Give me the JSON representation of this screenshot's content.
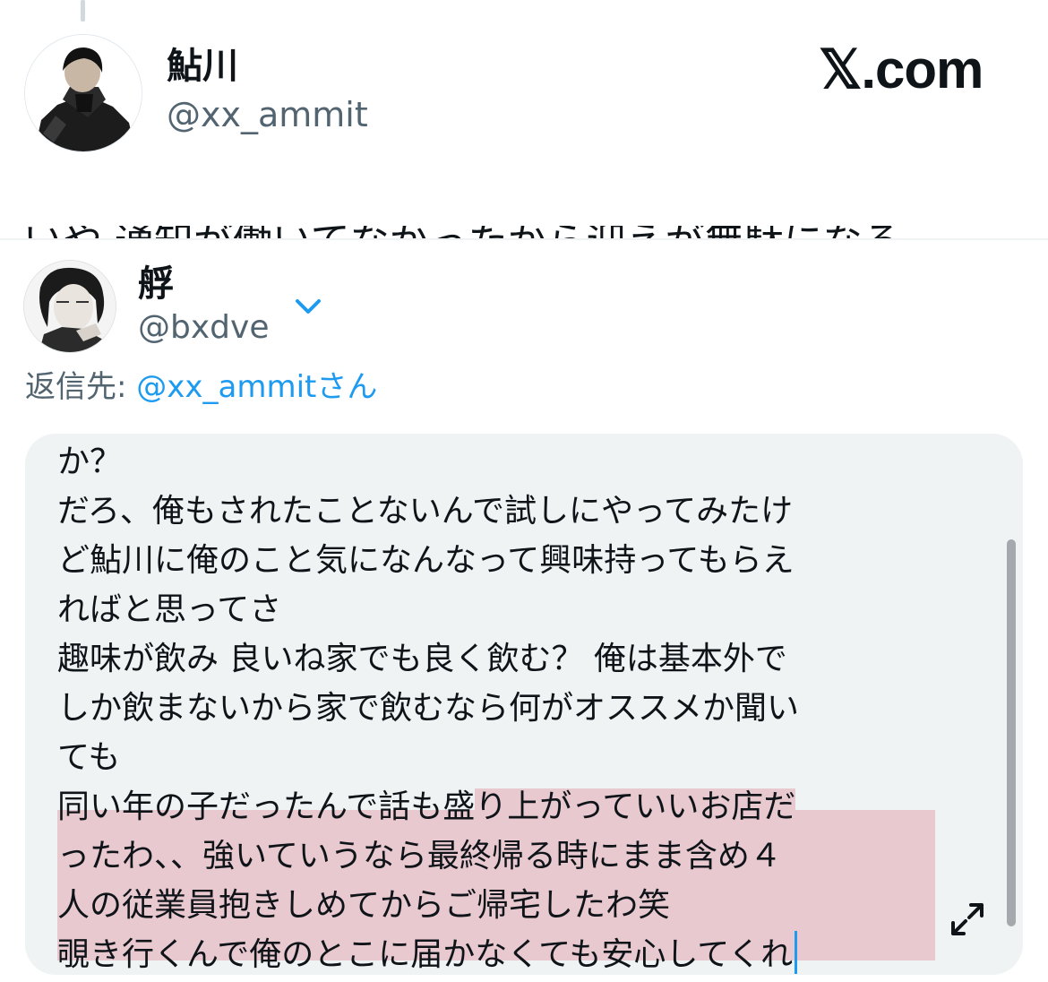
{
  "original_tweet": {
    "author_name": "鮎川",
    "author_handle": "@xx_ammit",
    "brand": "𝕏.com",
    "truncated_text": "いや 通知が働いてなかったから迎えが無駄になる"
  },
  "reply": {
    "author_name": "艀",
    "author_handle": "@bxdve",
    "reply_to_label": "返信先:",
    "reply_to_handle": "@xx_ammit",
    "reply_to_suffix": "さん",
    "lines": [
      "か？",
      "だろ、俺もされたことないんで試しにやってみたけ",
      "ど鮎川に俺のこと気になんなって興味持ってもらえ",
      "ればと思ってさ",
      "趣味が飲み 良いね家でも良く飲む？ 俺は基本外で",
      "しか飲まないから家で飲むなら何がオススメか聞い",
      "ても",
      "同い年の子だったんで話も盛",
      "り上がっていいお店だ",
      "ったわ、、強いていうなら最終帰る時にまま含め４",
      "人の従業員抱きしめてからご帰宅したわ笑",
      "覗き行くんで俺のとこに届かなくても安心してくれ"
    ]
  },
  "colors": {
    "link": "#1d9bf0",
    "highlight": "#e8c9cf",
    "composer_bg": "#eff3f4",
    "secondary_text": "#536471"
  },
  "icons": {
    "chevron": "chevron-down-icon",
    "expand": "expand-icon"
  }
}
